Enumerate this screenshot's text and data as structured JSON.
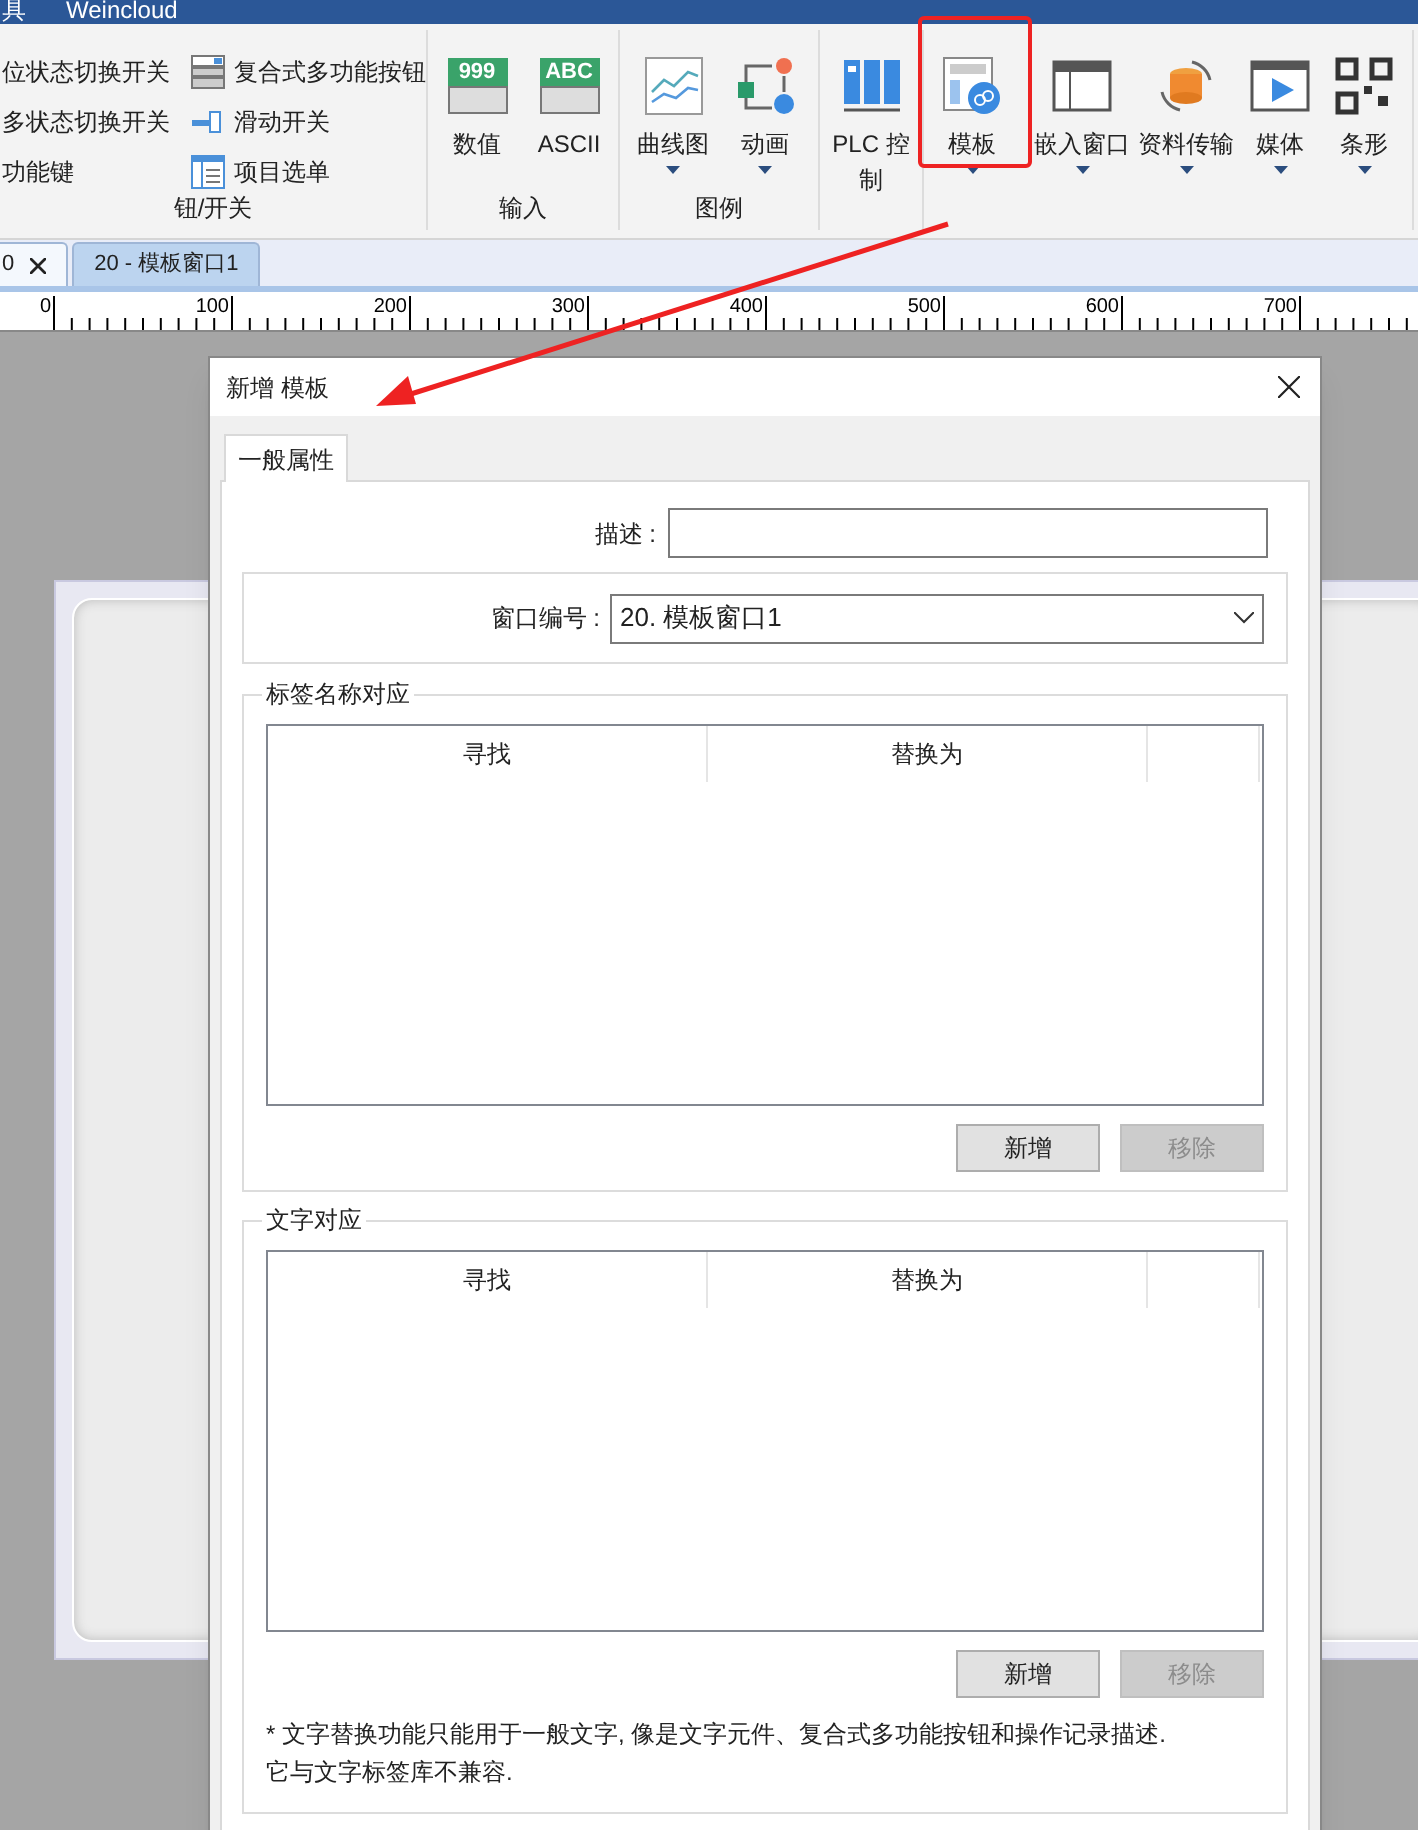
{
  "menu_bar": [
    "具",
    "Weincloud"
  ],
  "ribbon": {
    "groups": [
      {
        "kind": "list",
        "label": "钮/开关",
        "columns": [
          [
            "位状态切换开关",
            "多状态切换开关",
            "功能键"
          ],
          [
            "复合式多功能按钮",
            "滑动开关",
            "项目选单"
          ]
        ]
      },
      {
        "kind": "large",
        "label": "输入",
        "items": [
          {
            "label": "数值",
            "icon_text": "999",
            "dropdown": false
          },
          {
            "label": "ASCII",
            "icon_text": "ABC",
            "dropdown": false
          }
        ]
      },
      {
        "kind": "large",
        "label": "图例",
        "items": [
          {
            "label": "曲线图",
            "dropdown": true
          },
          {
            "label": "动画",
            "dropdown": true
          }
        ]
      },
      {
        "kind": "large",
        "items": [
          {
            "label": "PLC 控制",
            "dropdown": false
          }
        ]
      },
      {
        "kind": "large",
        "items": [
          {
            "label": "模板",
            "dropdown": true
          },
          {
            "label": "嵌入窗口",
            "dropdown": true
          },
          {
            "label": "资料传输",
            "dropdown": true
          },
          {
            "label": "媒体",
            "dropdown": true
          },
          {
            "label": "条形",
            "dropdown": true
          }
        ]
      }
    ]
  },
  "document_tabs": [
    {
      "label": "0",
      "selected": true,
      "closable": true
    },
    {
      "label": "20 - 模板窗口1",
      "selected": false,
      "closable": false
    }
  ],
  "ruler": {
    "labels": [
      "0",
      "100",
      "200",
      "300",
      "400",
      "500",
      "600",
      "700"
    ]
  },
  "dialog": {
    "title": "新增 模板",
    "tabs": [
      {
        "label": "一般属性",
        "selected": true
      }
    ],
    "description": {
      "label": "描述 :"
    },
    "window_number": {
      "label": "窗口编号 :",
      "value": "20. 模板窗口1"
    },
    "groups": [
      {
        "title": "标签名称对应",
        "columns": [
          "寻找",
          "替换为"
        ],
        "buttons": [
          {
            "label": "新增",
            "disabled": false
          },
          {
            "label": "移除",
            "disabled": true
          }
        ]
      },
      {
        "title": "文字对应",
        "columns": [
          "寻找",
          "替换为"
        ],
        "buttons": [
          {
            "label": "新增",
            "disabled": false
          },
          {
            "label": "移除",
            "disabled": true
          }
        ],
        "note": [
          "* 文字替换功能只能用于一般文字, 像是文字元件、复合式多功能按钮和操作记录描述.",
          "它与文字标签库不兼容."
        ]
      }
    ]
  }
}
